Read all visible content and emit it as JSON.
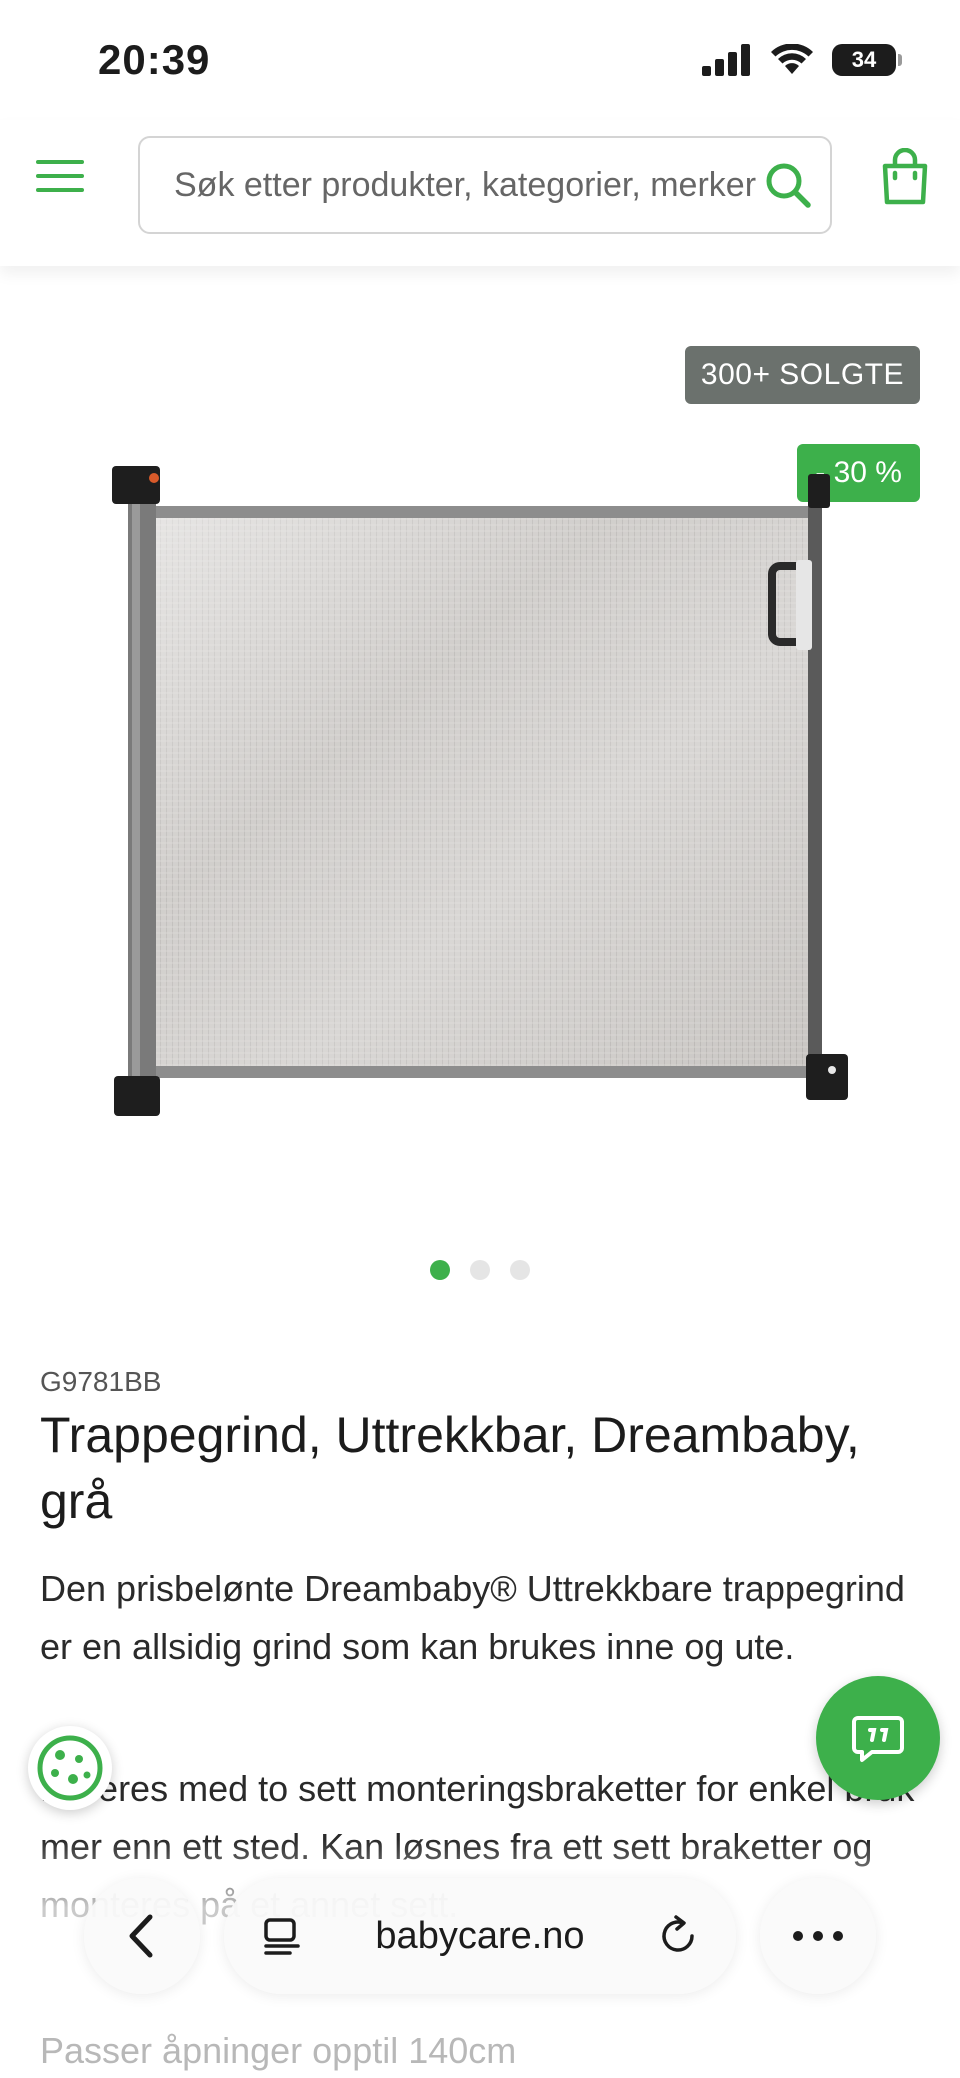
{
  "status_bar": {
    "time": "20:39",
    "battery": "34",
    "battery_level": 0.34
  },
  "header": {
    "menu_icon": "hamburger-menu-icon",
    "search_placeholder": "Søk etter produkter, kategorier, merker",
    "search_icon": "search-icon",
    "cart_icon": "shopping-bag-icon"
  },
  "colors": {
    "accent": "#3db04b",
    "sold_badge": "#6b716d"
  },
  "gallery": {
    "sold_badge": "300+ SOLGTE",
    "discount_badge": "- 30 %",
    "image_alt": "Trappegrind, Uttrekkbar, Dreambaby, grå",
    "slide_count": 3,
    "active_slide": 1
  },
  "product": {
    "sku": "G9781BB",
    "title": "Trappegrind, Uttrekkbar, Dreambaby, grå",
    "description_1": "Den prisbelønte Dreambaby® Uttrekkbare trappegrind er en allsidig grind som kan brukes inne og ute.",
    "description_2": "Leveres med to sett monteringsbraketter for enkel bruk mer enn ett sted. Kan løsnes fra ett sett braketter og monteres på et annet sett.",
    "description_3": "Passer åpninger opptil 140cm"
  },
  "floating": {
    "chat_icon": "chat-bubble-icon",
    "cookie_icon": "cookie-icon"
  },
  "browser_bar": {
    "back_icon": "chevron-left-icon",
    "tabs_icon": "reader-icon",
    "url": "babycare.no",
    "reload_icon": "reload-icon",
    "more_icon": "more-dots-icon"
  }
}
